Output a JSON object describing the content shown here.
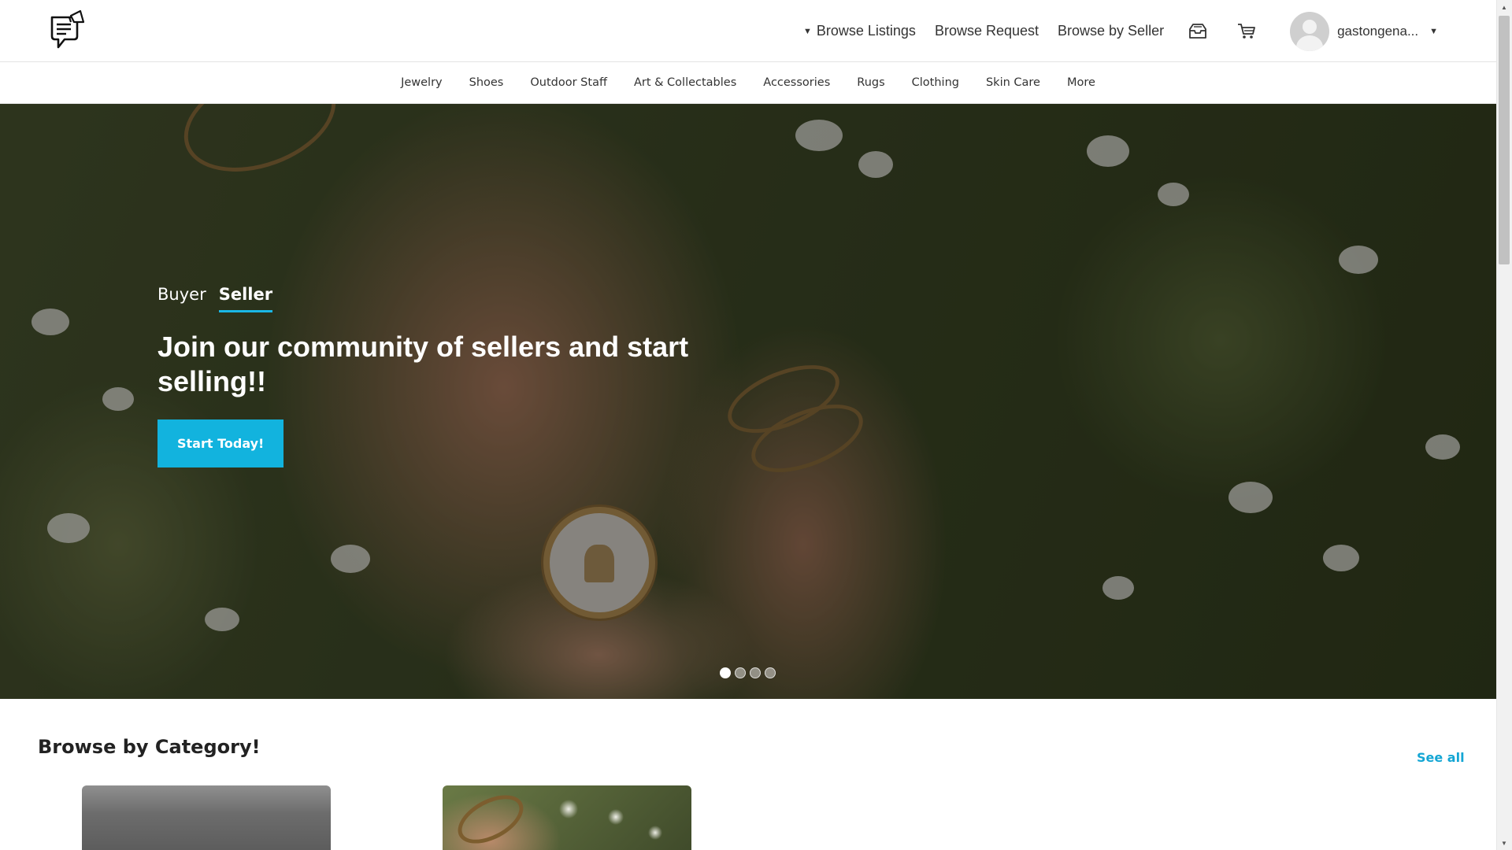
{
  "header": {
    "logo_icon": "chat-megaphone-logo",
    "nav": {
      "browse_listings": "Browse Listings",
      "browse_request": "Browse Request",
      "browse_by_seller": "Browse by Seller"
    },
    "icons": [
      "inbox-icon",
      "cart-icon"
    ],
    "user": {
      "name": "gastongena..."
    }
  },
  "categories": {
    "items": [
      "Jewelry",
      "Shoes",
      "Outdoor Staff",
      "Art & Collectables",
      "Accessories",
      "Rugs",
      "Clothing",
      "Skin Care",
      "More"
    ]
  },
  "hero": {
    "tabs": {
      "buyer": "Buyer",
      "seller": "Seller",
      "active": "Seller"
    },
    "headline": "Join our community of sellers and start selling!!",
    "cta": "Start Today!",
    "slides": {
      "count": 4,
      "active_index": 0
    },
    "accent_color": "#12b3de"
  },
  "category_section": {
    "title": "Browse by Category!",
    "see_all": "See all"
  }
}
